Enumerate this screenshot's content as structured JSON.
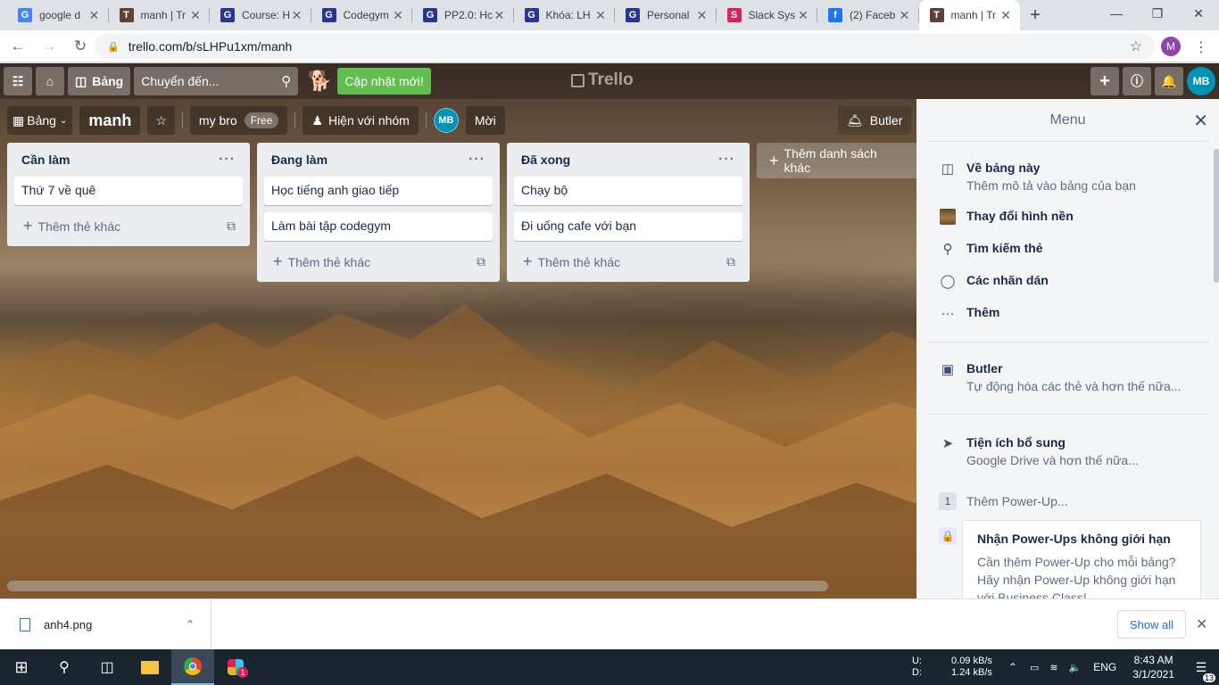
{
  "browser": {
    "tabs": [
      {
        "title": "google d",
        "icon": "G",
        "color": "#4285f4",
        "active": false
      },
      {
        "title": "manh | Tr",
        "icon": "T",
        "color": "#5d4037",
        "active": false
      },
      {
        "title": "Course: H",
        "icon": "G",
        "color": "#283593",
        "active": false
      },
      {
        "title": "Codegym",
        "icon": "G",
        "color": "#283593",
        "active": false
      },
      {
        "title": "PP2.0: Hc",
        "icon": "G",
        "color": "#283593",
        "active": false
      },
      {
        "title": "Khóa: LH",
        "icon": "G",
        "color": "#283593",
        "active": false
      },
      {
        "title": "Personal",
        "icon": "G",
        "color": "#283593",
        "active": false
      },
      {
        "title": "Slack Sys",
        "icon": "S",
        "color": "#e01e5a",
        "active": false
      },
      {
        "title": "(2) Faceb",
        "icon": "f",
        "color": "#1877f2",
        "active": false
      },
      {
        "title": "manh | Tr",
        "icon": "T",
        "color": "#5d4037",
        "active": true
      }
    ],
    "url": "trello.com/b/sLHPu1xm/manh",
    "profile_initial": "M"
  },
  "header": {
    "boards_label": "Bảng",
    "search_placeholder": "Chuyển đến...",
    "update_label": "Cập nhật mới!",
    "logo_text": "Trello",
    "avatar": "MB"
  },
  "board": {
    "view_label": "Bảng",
    "name": "manh",
    "team": "my bro",
    "team_badge": "Free",
    "visibility": "Hiện với nhóm",
    "member_avatar": "MB",
    "invite_label": "Mời",
    "butler_label": "Butler",
    "add_list_label": "Thêm danh sách khác",
    "add_card_label": "Thêm thẻ khác",
    "lists": [
      {
        "title": "Cần làm",
        "cards": [
          "Thứ 7 về quê"
        ]
      },
      {
        "title": "Đang làm",
        "cards": [
          "Học tiếng anh giao tiếp",
          "Làm bài tập codegym"
        ]
      },
      {
        "title": "Đã xong",
        "cards": [
          "Chạy bộ",
          "Đi uống cafe với bạn"
        ]
      }
    ]
  },
  "menu": {
    "title": "Menu",
    "about_title": "Về bảng này",
    "about_sub": "Thêm mô tả vào bảng của bạn",
    "change_bg": "Thay đổi hình nền",
    "search_cards": "Tìm kiếm thẻ",
    "stickers": "Các nhãn dán",
    "more": "Thêm",
    "butler_title": "Butler",
    "butler_sub": "Tự động hóa các thẻ và hơn thế nữa...",
    "powerups_title": "Tiện ích bổ sung",
    "powerups_sub": "Google Drive và hơn thế nữa...",
    "powerup_count": "1",
    "add_powerup": "Thêm Power-Up...",
    "promo_title": "Nhận Power-Ups không giới hạn",
    "promo_text": "Cần thêm Power-Up cho mỗi bảng? Hãy nhận Power-Up không giới hạn với Business Class!"
  },
  "downloads": {
    "file": "anh4.png",
    "show_all": "Show all"
  },
  "taskbar": {
    "net_up_label": "U:",
    "net_up": "0.09 kB/s",
    "net_down_label": "D:",
    "net_down": "1.24 kB/s",
    "lang": "ENG",
    "time": "8:43 AM",
    "date": "3/1/2021",
    "notifications": "13",
    "slack_badge": "1"
  }
}
